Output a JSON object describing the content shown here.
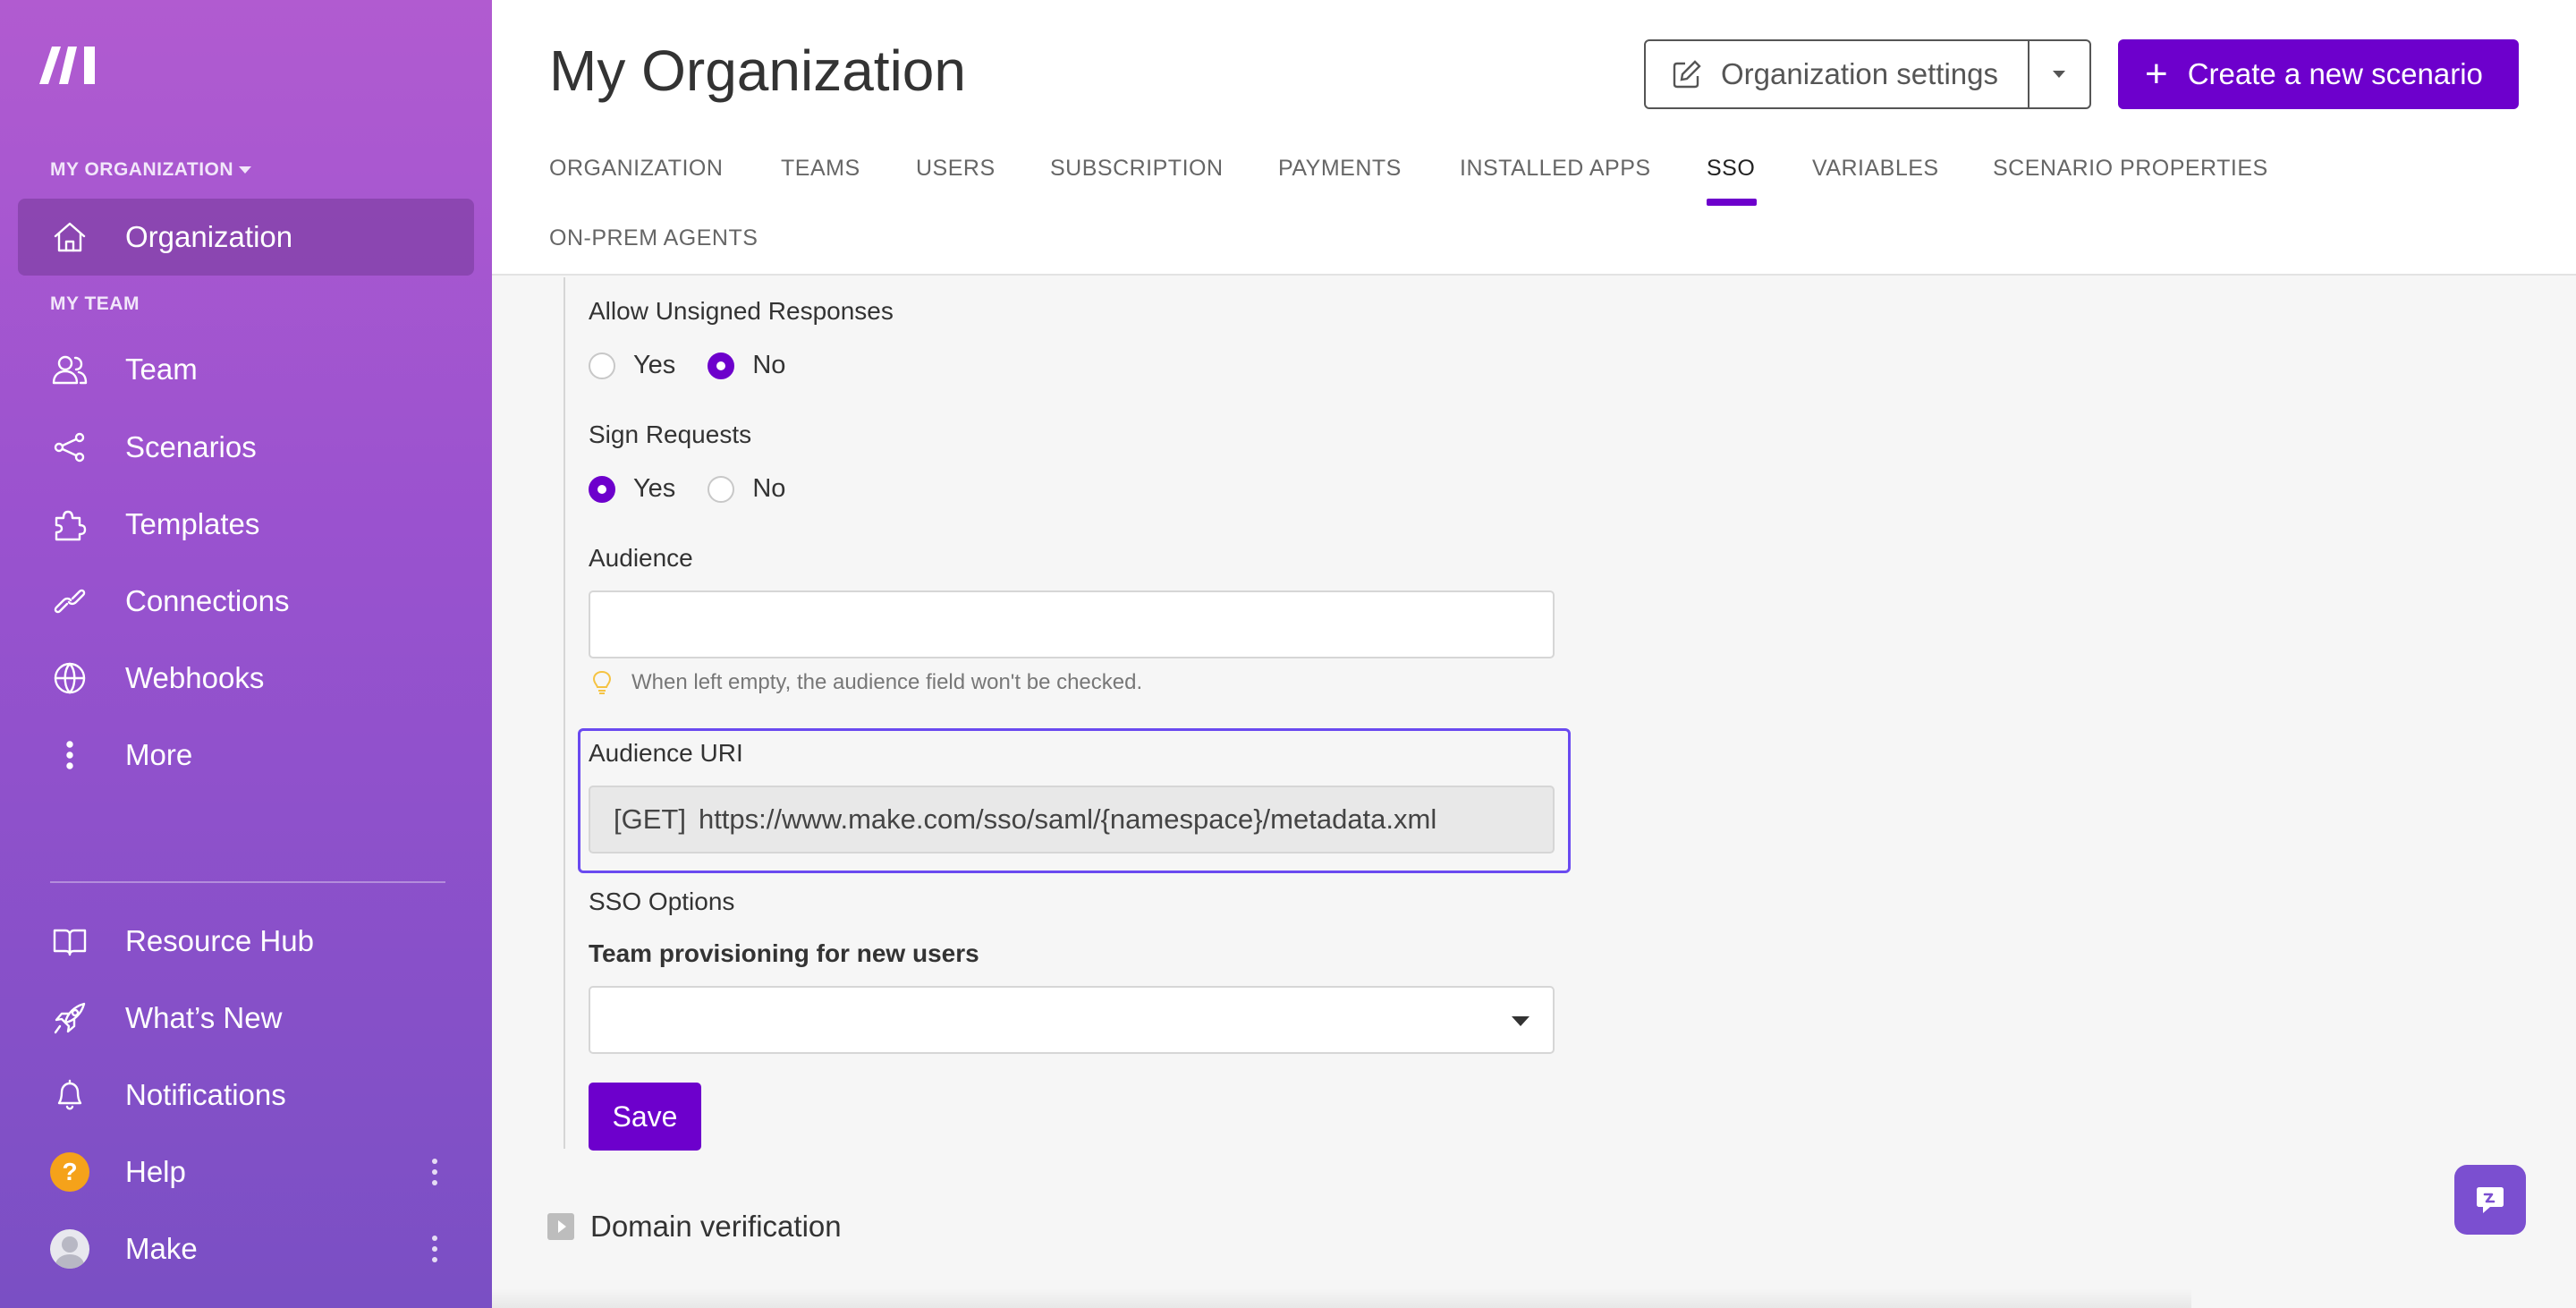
{
  "sidebar": {
    "org_section": "MY ORGANIZATION",
    "org_item": "Organization",
    "team_section": "MY TEAM",
    "items": [
      {
        "label": "Team",
        "icon": "users-icon"
      },
      {
        "label": "Scenarios",
        "icon": "share-nodes-icon"
      },
      {
        "label": "Templates",
        "icon": "puzzle-icon"
      },
      {
        "label": "Connections",
        "icon": "link-icon"
      },
      {
        "label": "Webhooks",
        "icon": "globe-icon"
      },
      {
        "label": "More",
        "icon": "vertical-dots-icon"
      }
    ],
    "bottom_items": [
      {
        "label": "Resource Hub",
        "icon": "book-icon"
      },
      {
        "label": "What’s New",
        "icon": "rocket-icon"
      },
      {
        "label": "Notifications",
        "icon": "bell-icon"
      },
      {
        "label": "Help",
        "icon": "question-icon"
      },
      {
        "label": "Make",
        "icon": "avatar-icon"
      }
    ]
  },
  "header": {
    "title": "My Organization",
    "settings_button": "Organization settings",
    "create_button": "Create a new scenario",
    "tabs": [
      {
        "label": "ORGANIZATION"
      },
      {
        "label": "TEAMS"
      },
      {
        "label": "USERS"
      },
      {
        "label": "SUBSCRIPTION"
      },
      {
        "label": "PAYMENTS"
      },
      {
        "label": "INSTALLED APPS"
      },
      {
        "label": "SSO",
        "active": true
      },
      {
        "label": "VARIABLES"
      },
      {
        "label": "SCENARIO PROPERTIES"
      },
      {
        "label": "ON-PREM AGENTS"
      }
    ]
  },
  "form": {
    "unsigned_label": "Allow Unsigned Responses",
    "unsigned_yes": "Yes",
    "unsigned_no": "No",
    "unsigned_value": "No",
    "sign_label": "Sign Requests",
    "sign_yes": "Yes",
    "sign_no": "No",
    "sign_value": "Yes",
    "audience_label": "Audience",
    "audience_value": "",
    "audience_hint": "When left empty, the audience field won't be checked.",
    "audience_uri_label": "Audience URI",
    "audience_uri_method": "[GET]",
    "audience_uri_value": "https://www.make.com/sso/saml/{namespace}/metadata.xml",
    "sso_options_label": "SSO Options",
    "team_provisioning_label": "Team provisioning for new users",
    "team_provisioning_value": "",
    "save_button": "Save",
    "domain_verification": "Domain verification"
  },
  "colors": {
    "accent": "#6d00cc",
    "sidebar_top": "#b15bd0",
    "sidebar_bottom": "#7a4fc4",
    "highlight_border": "#6a4af0"
  }
}
